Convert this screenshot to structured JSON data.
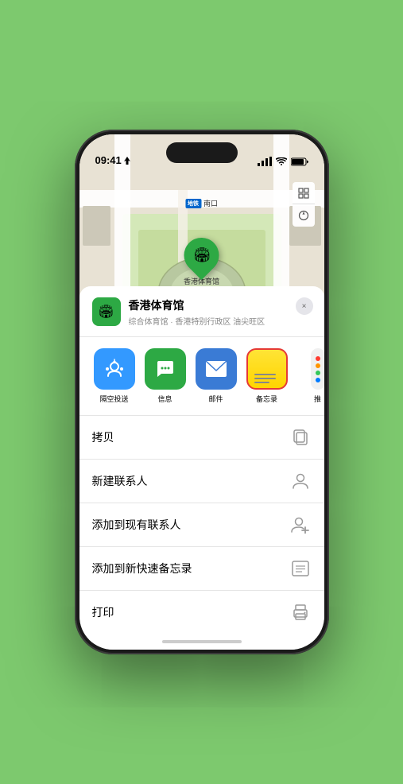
{
  "status_bar": {
    "time": "09:41",
    "location_icon": "▶",
    "signal_bars": "▌▌▌",
    "wifi_icon": "wifi",
    "battery_icon": "battery"
  },
  "map": {
    "subway_badge": "地铁",
    "subway_label": "南口",
    "pin_label": "香港体育馆",
    "controls": {
      "map_icon": "⊞",
      "location_icon": "◎"
    }
  },
  "venue": {
    "name": "香港体育馆",
    "subtitle": "综合体育馆 · 香港特别行政区 油尖旺区",
    "icon": "🏟"
  },
  "share_items": [
    {
      "id": "airdrop",
      "label": "隔空投送",
      "style": "airdrop"
    },
    {
      "id": "messages",
      "label": "信息",
      "style": "messages"
    },
    {
      "id": "mail",
      "label": "邮件",
      "style": "mail"
    },
    {
      "id": "notes",
      "label": "备忘录",
      "style": "notes"
    },
    {
      "id": "more",
      "label": "推",
      "style": "more"
    }
  ],
  "actions": [
    {
      "id": "copy",
      "label": "拷贝",
      "icon": "copy"
    },
    {
      "id": "new-contact",
      "label": "新建联系人",
      "icon": "person"
    },
    {
      "id": "add-existing",
      "label": "添加到现有联系人",
      "icon": "person-plus"
    },
    {
      "id": "add-notes",
      "label": "添加到新快速备忘录",
      "icon": "note"
    },
    {
      "id": "print",
      "label": "打印",
      "icon": "printer"
    }
  ],
  "close_label": "×",
  "colors": {
    "green": "#2da944",
    "highlight_border": "#e53935"
  }
}
